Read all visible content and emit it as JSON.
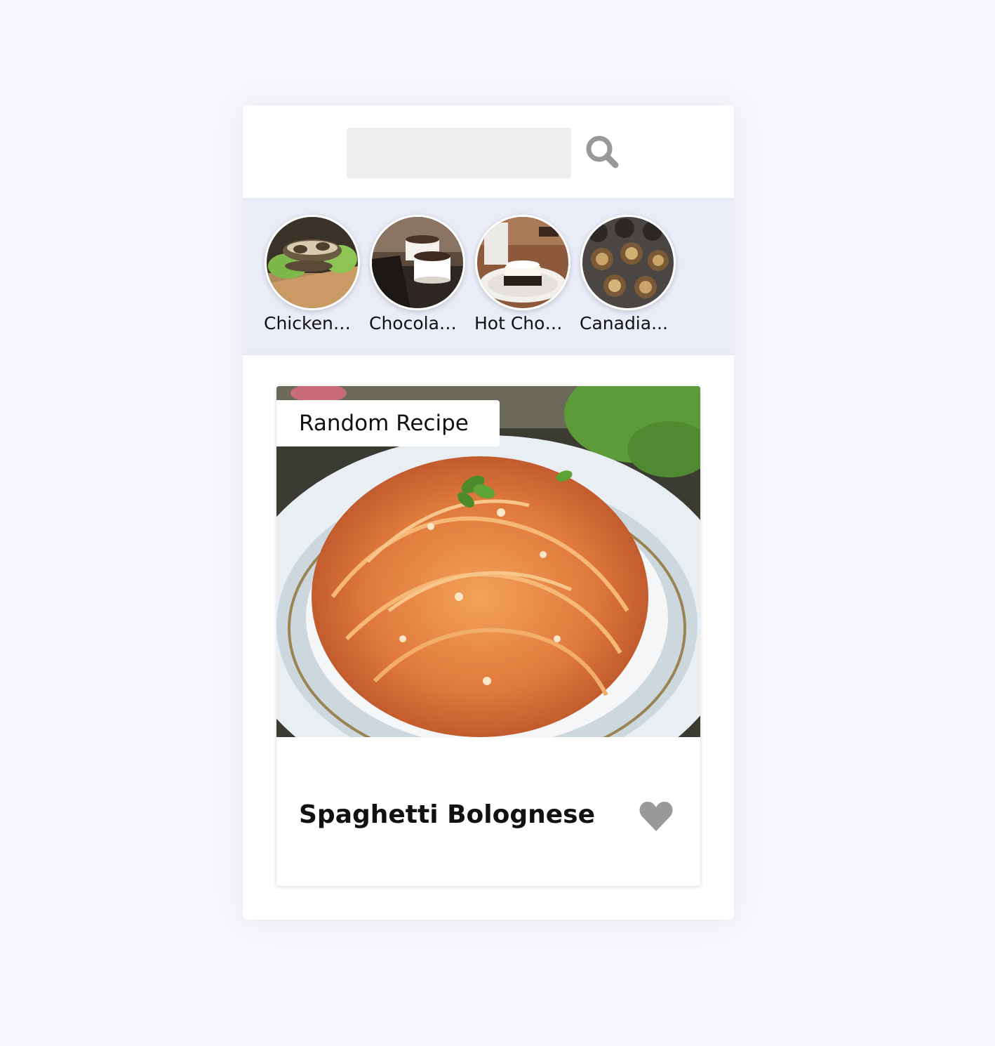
{
  "search": {
    "value": "",
    "placeholder": ""
  },
  "icons": {
    "search": "search-icon",
    "favorite": "heart-icon"
  },
  "favorites": [
    {
      "label": "Chicken ...",
      "image": "chicken-dish"
    },
    {
      "label": "Chocolat...",
      "image": "chocolate-souffle"
    },
    {
      "label": "Hot Choc...",
      "image": "hot-chocolate-cake"
    },
    {
      "label": "Canadia...",
      "image": "butter-tarts"
    }
  ],
  "meal": {
    "tag": "Random Recipe",
    "title": "Spaghetti Bolognese",
    "image": "spaghetti-bolognese"
  },
  "colors": {
    "page_bg": "#f7f7fb",
    "favorites_strip": "#eaedf8",
    "icon_gray": "#999999",
    "input_bg": "#eeeeee"
  }
}
